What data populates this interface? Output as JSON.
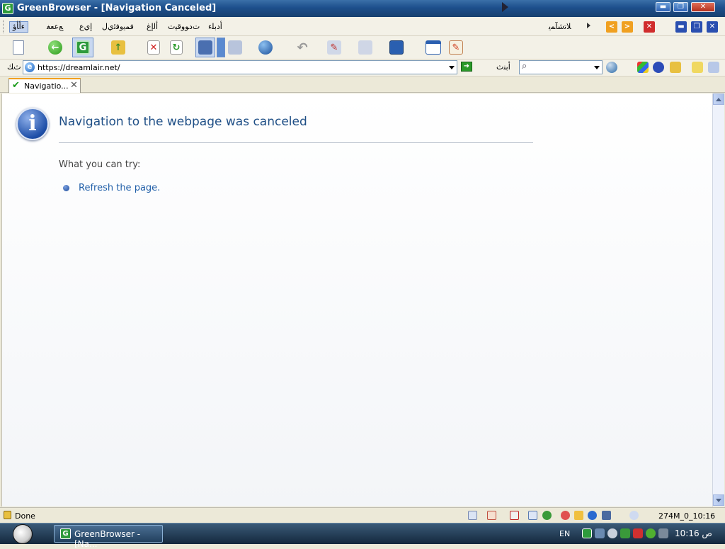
{
  "window": {
    "title": "GreenBrowser - [Navigation Canceled]",
    "app_icon_letter": "G",
    "minimize_glyph": "▬",
    "maximize_glyph": "❐",
    "close_glyph": "✕"
  },
  "menu": {
    "items": [
      "ﺀﺃﺄﺅ",
      "ﻊﻋﻌﻐ",
      "ﺇﻱﻉ",
      "ﻓﻤﻳﻭﻓﺋﻱﻝ",
      "ﺃﻟﺇﻍ",
      "ﺕﺩﻮﻭﻗﻴﺕ",
      "ﺃﺩﺑﻠﺀ"
    ],
    "right_label": "ﻼﺗﺷﺂﻤﻳ",
    "prev_page_glyph": "<",
    "next_page_glyph": ">",
    "close_tab_glyph": "✕",
    "doc_min_glyph": "▬",
    "doc_restore_glyph": "❐",
    "doc_close_glyph": "✕"
  },
  "toolbar": {
    "new_glyph": "",
    "back_glyph": "←",
    "home_glyph": "G",
    "up_glyph": "↑",
    "stop_glyph": "✕",
    "refresh_glyph": "↻",
    "undo_glyph": "↶",
    "tools_glyph": "✎",
    "pen_glyph": "✎"
  },
  "address": {
    "label": "ﺙﻚ",
    "url": "https://dreamlair.net/",
    "go_glyph": "➜",
    "search_label": "ﺃﺑﻨﺙ",
    "search_value": "",
    "search_icon_glyph": "⌕"
  },
  "tabs": [
    {
      "title": "Navigatio...",
      "status_glyph": "✔",
      "close_glyph": "✕"
    }
  ],
  "page": {
    "info_icon_glyph": "i",
    "heading": "Navigation to the webpage was canceled",
    "try_label": "What you can try:",
    "suggestions": [
      "Refresh the page."
    ]
  },
  "status": {
    "text": "Done",
    "right_text": "274M_0_10:16"
  },
  "taskbar": {
    "task_label": "GreenBrowser - [Na...",
    "task_icon_letter": "G",
    "language": "EN",
    "clock": "10:16 ﺹ"
  },
  "colors": {
    "title_bar": "#1d4f8c",
    "heading_text": "#1f4f86",
    "link": "#1f5ea8",
    "content_bg": "#ffffff"
  }
}
